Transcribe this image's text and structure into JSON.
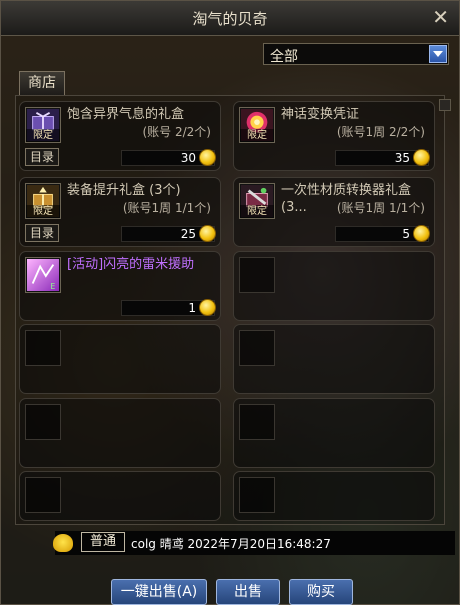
{
  "window": {
    "title": "淘气的贝奇",
    "close_label": "✕"
  },
  "filter": {
    "selected": "全部"
  },
  "tabs": [
    {
      "label": "商店"
    }
  ],
  "items": [
    {
      "name": "饱含异界气息的礼盒",
      "sub": "(账号 2/2个)",
      "price": "30",
      "limit": "限定",
      "catalog": "目录",
      "icon": "gift-box-icon"
    },
    {
      "name": "神话变换凭证",
      "sub": "(账号1周 2/2个)",
      "price": "35",
      "limit": "限定",
      "icon": "voucher-icon"
    },
    {
      "name": "装备提升礼盒 (3个)",
      "sub": "(账号1周 1/1个)",
      "price": "25",
      "limit": "限定",
      "catalog": "目录",
      "icon": "upgrade-box-icon"
    },
    {
      "name": "一次性材质转换器礼盒 (3...",
      "sub": "(账号1周 1/1个)",
      "price": "5",
      "limit": "限定",
      "icon": "converter-box-icon"
    },
    {
      "name": "[活动]闪亮的雷米援助",
      "price": "1",
      "icon": "remi-aid-icon"
    }
  ],
  "chat": {
    "channel": "普通",
    "message": "colg 晴鸢 2022年7月20日16:48:27"
  },
  "buttons": {
    "sell_all": "一键出售(A)",
    "sell": "出售",
    "buy": "购买"
  },
  "colors": {
    "accent": "#3d62a0",
    "coin": "#f2c10f",
    "event_name": "#c070ff"
  }
}
